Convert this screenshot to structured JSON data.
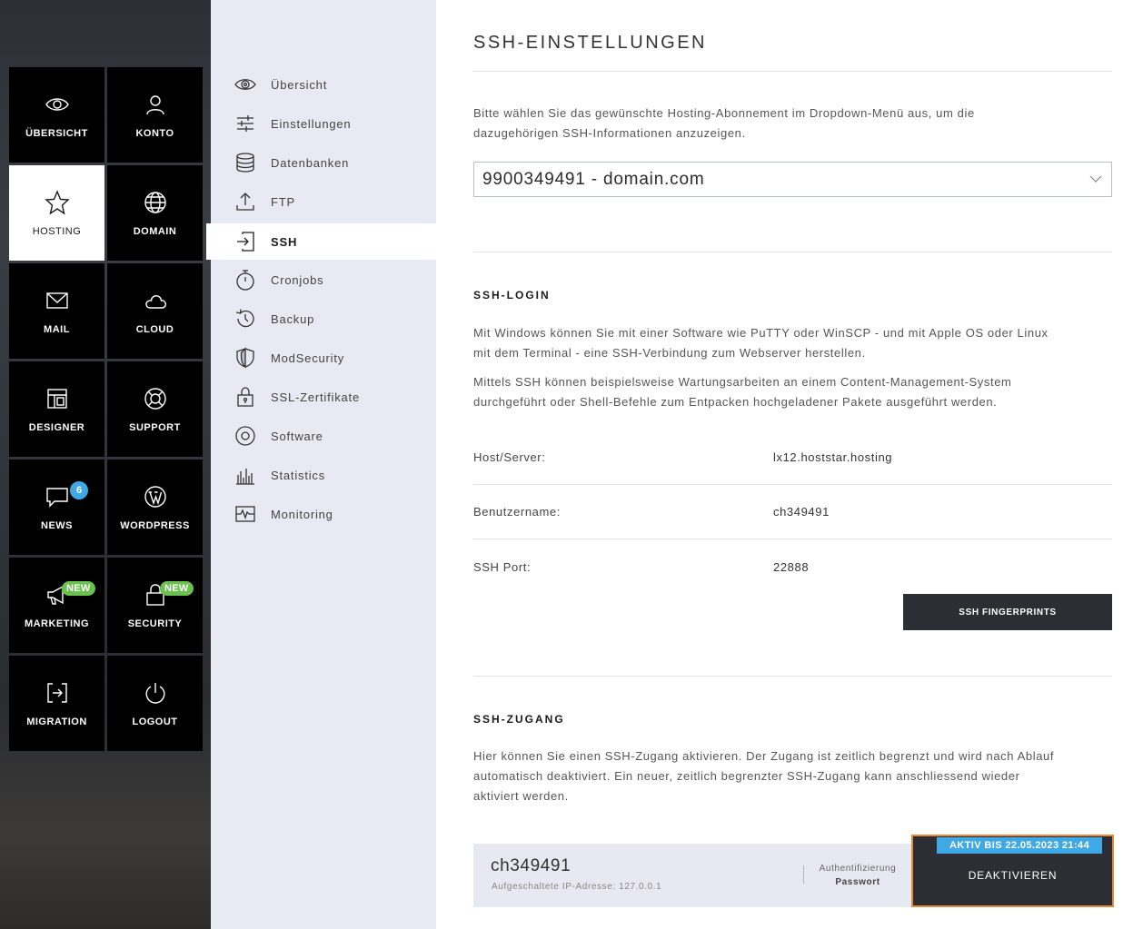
{
  "tiles": [
    {
      "label": "ÜBERSICHT",
      "icon": "eye-icon"
    },
    {
      "label": "KONTO",
      "icon": "user-icon"
    },
    {
      "label": "HOSTING",
      "icon": "star-icon"
    },
    {
      "label": "DOMAIN",
      "icon": "globe-icon"
    },
    {
      "label": "MAIL",
      "icon": "envelope-icon"
    },
    {
      "label": "CLOUD",
      "icon": "cloud-icon"
    },
    {
      "label": "DESIGNER",
      "icon": "layout-icon"
    },
    {
      "label": "SUPPORT",
      "icon": "lifebuoy-icon"
    },
    {
      "label": "NEWS",
      "icon": "chat-icon",
      "badge": "6"
    },
    {
      "label": "WORDPRESS",
      "icon": "wordpress-icon"
    },
    {
      "label": "MARKETING",
      "icon": "megaphone-icon",
      "badge": "NEW"
    },
    {
      "label": "SECURITY",
      "icon": "lock-icon",
      "badge": "NEW"
    },
    {
      "label": "MIGRATION",
      "icon": "migration-icon"
    },
    {
      "label": "LOGOUT",
      "icon": "power-icon"
    }
  ],
  "submenu": [
    {
      "label": "Übersicht",
      "icon": "eye-icon"
    },
    {
      "label": "Einstellungen",
      "icon": "sliders-icon"
    },
    {
      "label": "Datenbanken",
      "icon": "database-icon"
    },
    {
      "label": "FTP",
      "icon": "upload-icon"
    },
    {
      "label": "SSH",
      "icon": "login-icon"
    },
    {
      "label": "Cronjobs",
      "icon": "stopwatch-icon"
    },
    {
      "label": "Backup",
      "icon": "history-icon"
    },
    {
      "label": "ModSecurity",
      "icon": "shield-icon"
    },
    {
      "label": "SSL-Zertifikate",
      "icon": "padlock-icon"
    },
    {
      "label": "Software",
      "icon": "disc-icon"
    },
    {
      "label": "Statistics",
      "icon": "barchart-icon"
    },
    {
      "label": "Monitoring",
      "icon": "pulse-icon"
    }
  ],
  "page": {
    "title": "SSH-EINSTELLUNGEN",
    "intro_line1": "Bitte wählen Sie das gewünschte Hosting-Abonnement im Dropdown-Menü aus, um die",
    "intro_line2": "dazugehörigen SSH-Informationen anzuzeigen.",
    "selected_subscription": "9900349491 - domain.com"
  },
  "login": {
    "heading": "SSH-LOGIN",
    "p1_line1": "Mit Windows können Sie mit einer Software wie PuTTY oder WinSCP - und mit Apple OS oder Linux",
    "p1_line2": "mit dem Terminal - eine SSH-Verbindung zum Webserver herstellen.",
    "p2_line1": "Mittels SSH können beispielsweise Wartungsarbeiten an einem Content-Management-System",
    "p2_line2": "durchgeführt oder Shell-Befehle zum Entpacken hochgeladener Pakete ausgeführt werden.",
    "host_label": "Host/Server:",
    "host_value": "lx12.hoststar.hosting",
    "user_label": "Benutzername:",
    "user_value": "ch349491",
    "port_label": "SSH Port:",
    "port_value": "22888",
    "fingerprints_button": "SSH FINGERPRINTS"
  },
  "access": {
    "heading": "SSH-ZUGANG",
    "p_line1": "Hier können Sie einen SSH-Zugang aktivieren. Der Zugang ist zeitlich begrenzt und wird nach Ablauf",
    "p_line2": "automatisch deaktiviert. Ein neuer, zeitlich begrenzter SSH-Zugang kann anschliessend wieder",
    "p_line3": "aktiviert werden.",
    "username": "ch349491",
    "ip_text": "Aufgeschaltete IP-Adresse: 127.0.0.1",
    "auth_label": "Authentifizierung",
    "auth_value": "Passwort",
    "active_badge": "AKTIV BIS 22.05.2023 21:44",
    "deactivate_button": "DEAKTIVIEREN"
  },
  "colors": {
    "accent_blue": "#3fa9e6",
    "new_green": "#69c14e",
    "highlight_orange": "#e8883a",
    "dark_button": "#2d2e33"
  }
}
